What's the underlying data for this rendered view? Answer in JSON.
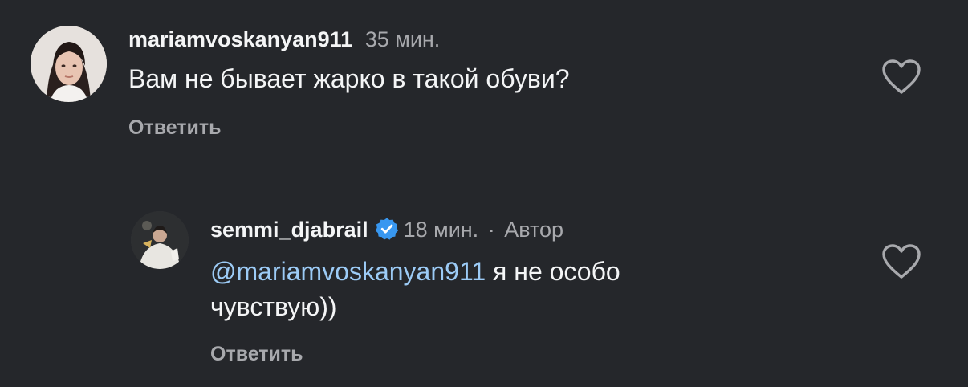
{
  "comments": [
    {
      "username": "mariamvoskanyan911",
      "time": "35 мин.",
      "text": "Вам не бывает жарко в такой обуви?",
      "reply_label": "Ответить",
      "avatar_icon": "user-avatar-photo",
      "like_icon": "heart-outline-icon"
    },
    {
      "username": "semmi_djabrail",
      "verified": true,
      "time": "18 мин.",
      "separator": "·",
      "author_label": "Автор",
      "mention": "@mariamvoskanyan911",
      "text_line1": " я не особо",
      "text_line2": "чувствую))",
      "reply_label": "Ответить",
      "avatar_icon": "user-avatar-photo",
      "like_icon": "heart-outline-icon"
    }
  ],
  "colors": {
    "background": "#25272b",
    "primary_text": "#f4f5f6",
    "secondary_text": "#a8a9ad",
    "mention": "#9ccbf6",
    "verified_badge": "#3897f0"
  }
}
